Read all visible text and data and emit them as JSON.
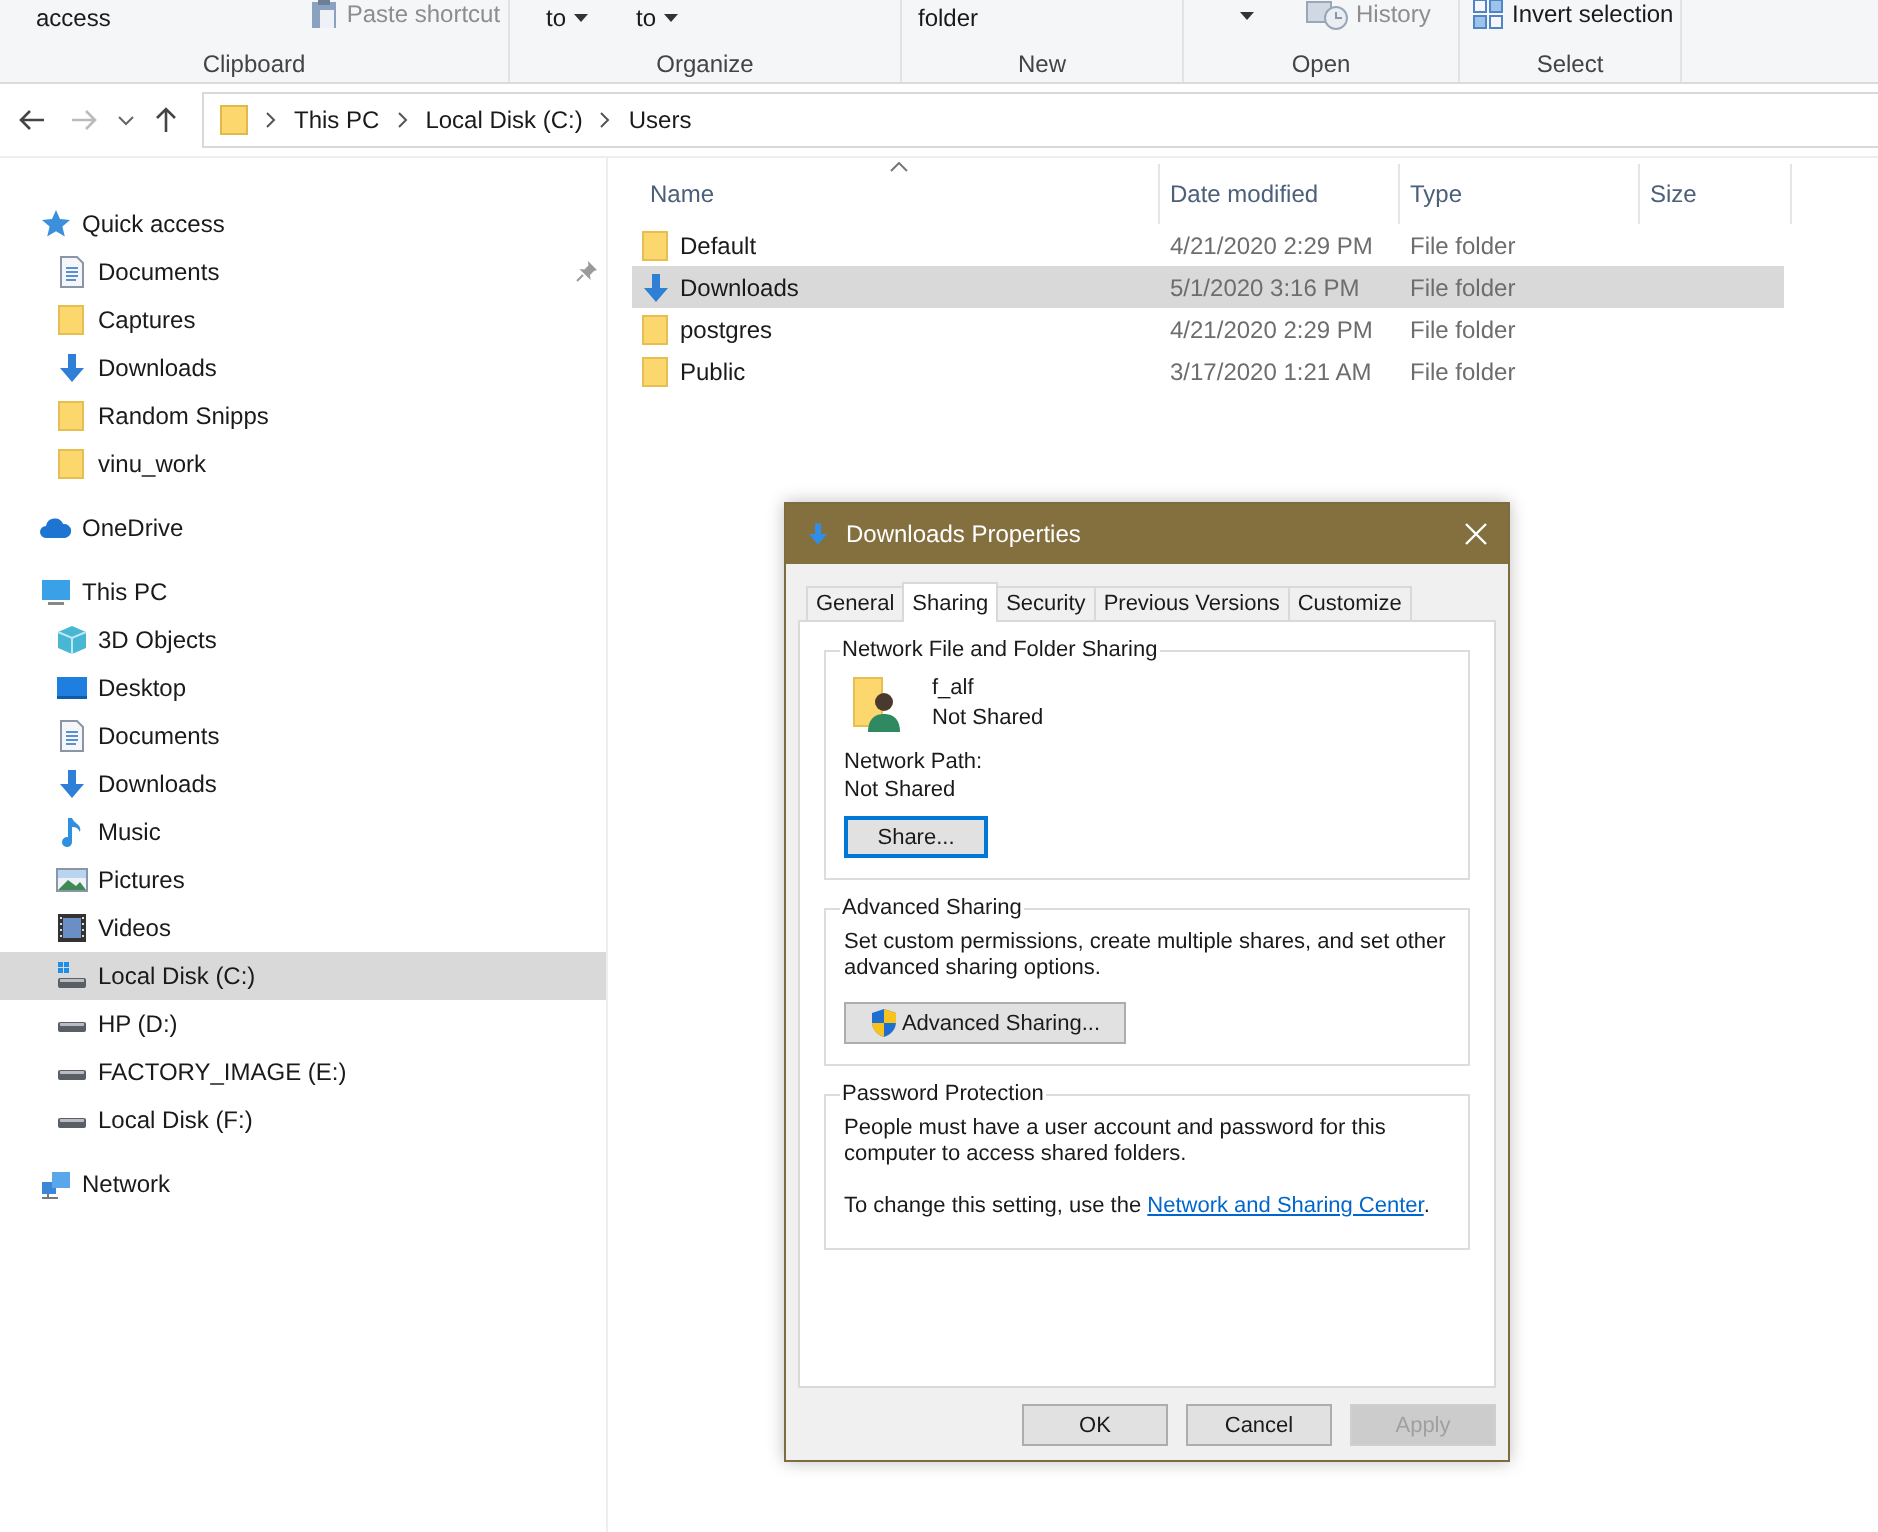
{
  "ribbon": {
    "groups": [
      {
        "label": "Clipboard",
        "items": [
          {
            "text": "access",
            "disabled": false,
            "kind": "text"
          },
          {
            "text": "Paste shortcut",
            "disabled": true,
            "kind": "paste"
          }
        ]
      },
      {
        "label": "Organize",
        "items": [
          {
            "text": "to",
            "disabled": false,
            "kind": "dropdown"
          },
          {
            "text": "to",
            "disabled": false,
            "kind": "dropdown"
          }
        ]
      },
      {
        "label": "New",
        "items": [
          {
            "text": "folder",
            "disabled": false,
            "kind": "text"
          }
        ]
      },
      {
        "label": "Open",
        "items": [
          {
            "disabled": false,
            "kind": "caret"
          },
          {
            "text": "History",
            "disabled": true,
            "kind": "history"
          }
        ]
      },
      {
        "label": "Select",
        "items": [
          {
            "text": "Invert selection",
            "disabled": false,
            "kind": "invert"
          }
        ]
      }
    ]
  },
  "address_bar": {
    "path": [
      "This PC",
      "Local Disk (C:)",
      "Users"
    ]
  },
  "sidebar": {
    "items": [
      {
        "label": "Quick access",
        "kind": "star",
        "selected": false,
        "children": [
          {
            "label": "Documents",
            "kind": "document",
            "selected": false,
            "pinned": true
          },
          {
            "label": "Captures",
            "kind": "folder",
            "selected": false,
            "pinned": false
          },
          {
            "label": "Downloads",
            "kind": "download",
            "selected": false,
            "pinned": false
          },
          {
            "label": "Random Snipps",
            "kind": "folder",
            "selected": false,
            "pinned": false
          },
          {
            "label": "vinu_work",
            "kind": "folder",
            "selected": false,
            "pinned": false
          }
        ]
      },
      {
        "label": "OneDrive",
        "kind": "cloud",
        "selected": false
      },
      {
        "label": "This PC",
        "kind": "pc",
        "selected": false,
        "children": [
          {
            "label": "3D Objects",
            "kind": "cube",
            "selected": false,
            "pinned": false
          },
          {
            "label": "Desktop",
            "kind": "desktop",
            "selected": false,
            "pinned": false
          },
          {
            "label": "Documents",
            "kind": "document",
            "selected": false,
            "pinned": false
          },
          {
            "label": "Downloads",
            "kind": "download",
            "selected": false,
            "pinned": false
          },
          {
            "label": "Music",
            "kind": "music",
            "selected": false,
            "pinned": false
          },
          {
            "label": "Pictures",
            "kind": "pictures",
            "selected": false,
            "pinned": false
          },
          {
            "label": "Videos",
            "kind": "videos",
            "selected": false,
            "pinned": false
          },
          {
            "label": "Local Disk (C:)",
            "kind": "sysdrive",
            "selected": true,
            "pinned": false
          },
          {
            "label": "HP (D:)",
            "kind": "drive",
            "selected": false,
            "pinned": false
          },
          {
            "label": "FACTORY_IMAGE (E:)",
            "kind": "drive",
            "selected": false,
            "pinned": false
          },
          {
            "label": "Local Disk (F:)",
            "kind": "drive",
            "selected": false,
            "pinned": false
          }
        ]
      },
      {
        "label": "Network",
        "kind": "network",
        "selected": false
      }
    ]
  },
  "table": {
    "columns": [
      "Name",
      "Date modified",
      "Type",
      "Size"
    ],
    "rows": [
      {
        "name": "Default",
        "kind": "folder",
        "date": "4/21/2020 2:29 PM",
        "type": "File folder",
        "selected": false
      },
      {
        "name": "Downloads",
        "kind": "download",
        "date": "5/1/2020 3:16 PM",
        "type": "File folder",
        "selected": true
      },
      {
        "name": "postgres",
        "kind": "folder",
        "date": "4/21/2020 2:29 PM",
        "type": "File folder",
        "selected": false
      },
      {
        "name": "Public",
        "kind": "folder",
        "date": "3/17/2020 1:21 AM",
        "type": "File folder",
        "selected": false
      }
    ]
  },
  "dialog": {
    "title": "Downloads Properties",
    "tabs": [
      {
        "label": "General",
        "selected": false
      },
      {
        "label": "Sharing",
        "selected": true
      },
      {
        "label": "Security",
        "selected": false
      },
      {
        "label": "Previous Versions",
        "selected": false
      },
      {
        "label": "Customize",
        "selected": false
      }
    ],
    "network_sharing": {
      "heading": "Network File and Folder Sharing",
      "folder_name": "f_alf",
      "status": "Not Shared",
      "path_label": "Network Path:",
      "path_value": "Not Shared",
      "button": {
        "label": "Share...",
        "focused": true
      }
    },
    "advanced_sharing": {
      "heading": "Advanced Sharing",
      "description": "Set custom permissions, create multiple shares, and set other advanced sharing options.",
      "button": {
        "label": "Advanced Sharing...",
        "focused": false
      }
    },
    "password_protection": {
      "heading": "Password Protection",
      "description": "People must have a user account and password for this computer to access shared folders.",
      "link_prefix": "To change this setting, use the ",
      "link": "Network and Sharing Center",
      "link_suffix": "."
    },
    "buttons": [
      {
        "label": "OK",
        "disabled": false
      },
      {
        "label": "Cancel",
        "disabled": false
      },
      {
        "label": "Apply",
        "disabled": true
      }
    ]
  }
}
